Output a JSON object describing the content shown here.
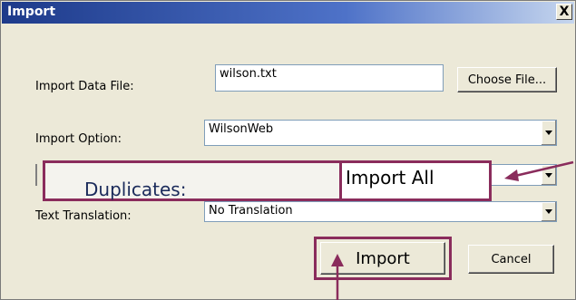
{
  "window": {
    "title": "Import",
    "close_glyph": "X"
  },
  "fields": {
    "import_data_file": {
      "label": "Import Data File:",
      "value": "wilson.txt"
    },
    "choose_file_label": "Choose File...",
    "import_option": {
      "label": "Import Option:",
      "value": "WilsonWeb"
    },
    "duplicates": {
      "label": "Duplicates:",
      "value": "Import All"
    },
    "text_translation": {
      "label": "Text Translation:",
      "value": "No Translation"
    }
  },
  "buttons": {
    "import_label": "Import",
    "cancel_label": "Cancel"
  },
  "colors": {
    "highlight": "#8a2c5c",
    "titlebar_start": "#1d3a8a",
    "dialog_bg": "#ece9d8"
  },
  "icons": [
    "close-icon",
    "chevron-down-icon",
    "annotation-arrow-icon"
  ]
}
